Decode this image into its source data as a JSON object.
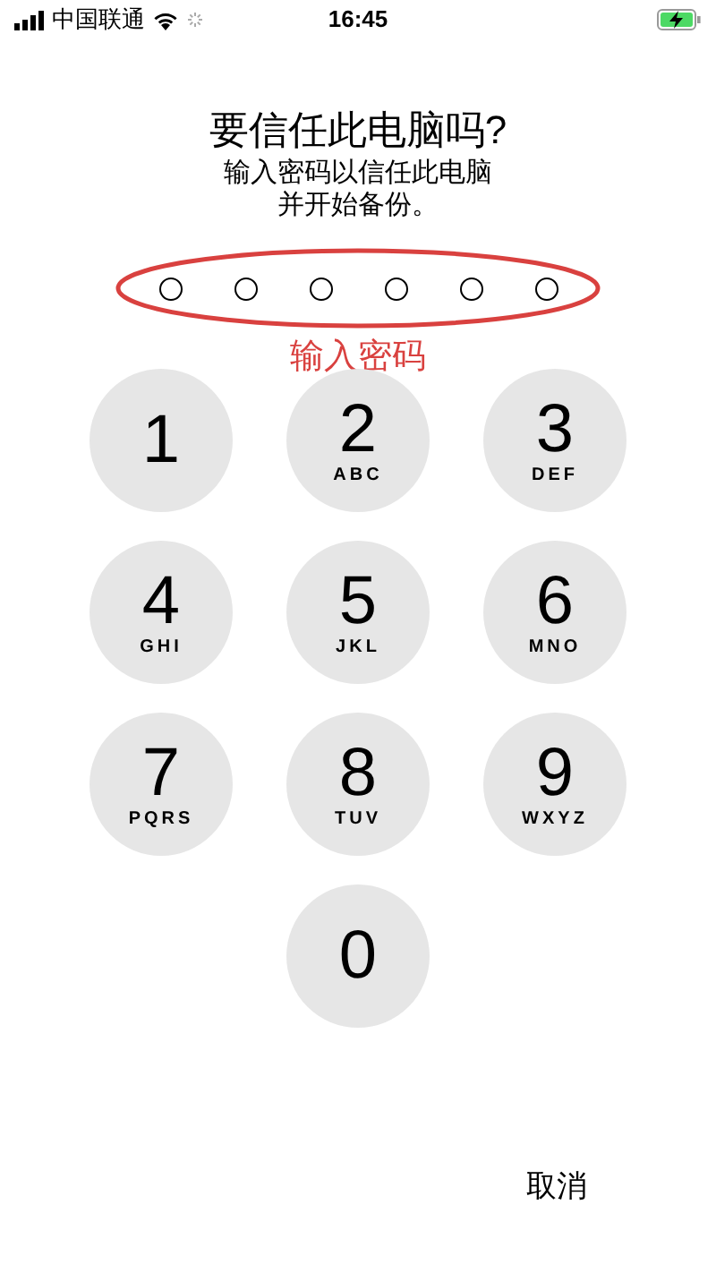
{
  "status_bar": {
    "carrier": "中国联通",
    "time": "16:45"
  },
  "title": "要信任此电脑吗?",
  "message_lines": [
    "输入密码以信任此电脑",
    "并开始备份。"
  ],
  "passcode_dots": [
    {
      "filled": false
    },
    {
      "filled": false
    },
    {
      "filled": false
    },
    {
      "filled": false
    },
    {
      "filled": false
    },
    {
      "filled": false
    }
  ],
  "annotation": "输入密码",
  "keys": [
    {
      "digit": "1"
    },
    {
      "digit": "2",
      "letters": "ABC"
    },
    {
      "digit": "3",
      "letters": "DEF"
    },
    {
      "digit": "4",
      "letters": "GHI"
    },
    {
      "digit": "5",
      "letters": "JKL"
    },
    {
      "digit": "6",
      "letters": "MNO"
    },
    {
      "digit": "7",
      "letters": "PQRS"
    },
    {
      "digit": "8",
      "letters": "TUV"
    },
    {
      "digit": "9",
      "letters": "WXYZ"
    },
    {
      "digit": "0"
    }
  ],
  "cancel": "取消"
}
